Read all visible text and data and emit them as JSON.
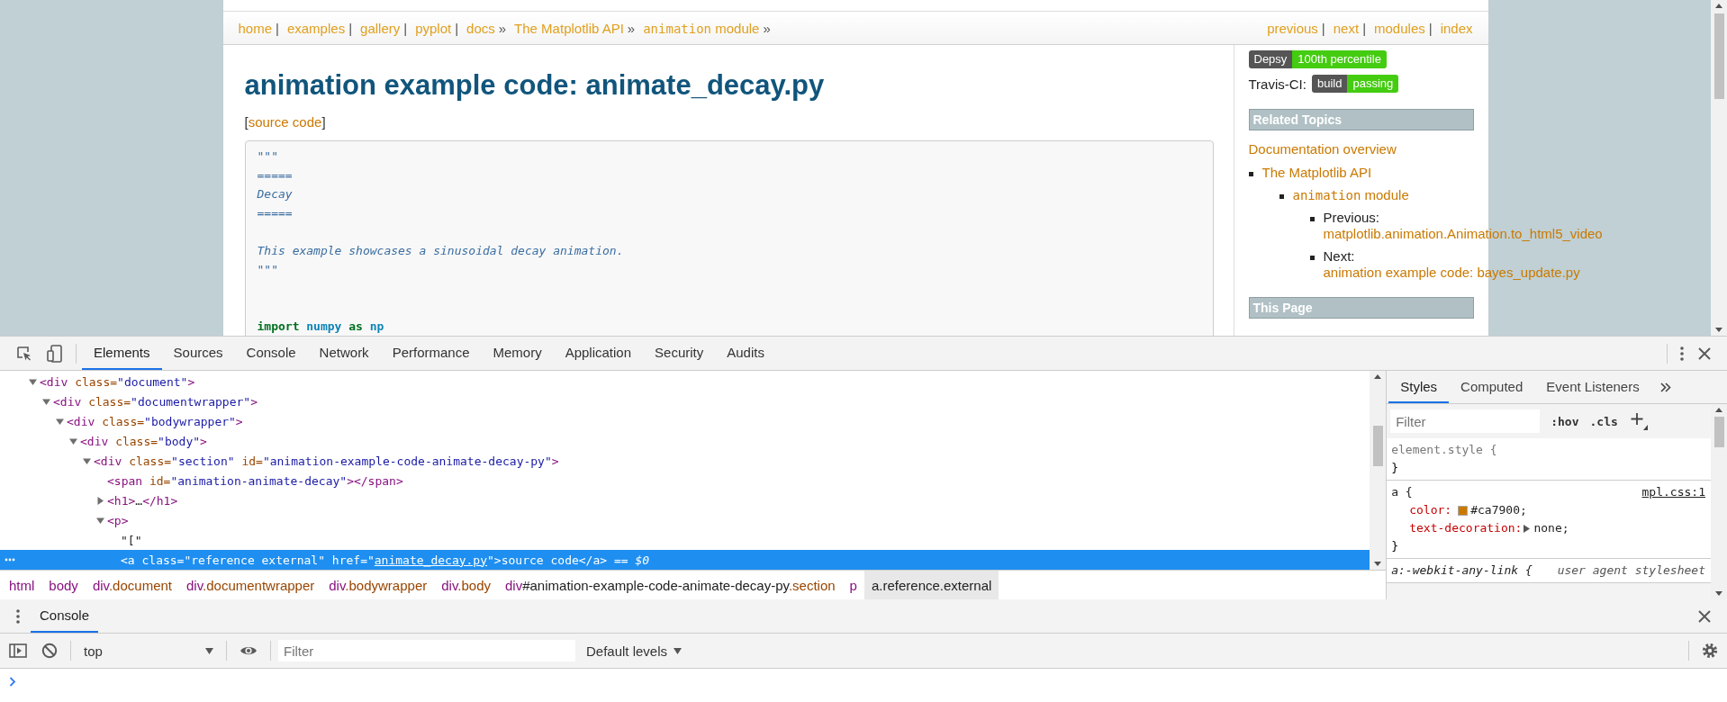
{
  "page": {
    "nav_left": [
      {
        "label": "home",
        "separator": "|"
      },
      {
        "label": "examples",
        "separator": "|"
      },
      {
        "label": "gallery",
        "separator": "|"
      },
      {
        "label": "pyplot",
        "separator": "|"
      },
      {
        "label": "docs",
        "separator": "»"
      },
      {
        "label": "The Matplotlib API",
        "separator": "»"
      },
      {
        "code": "animation",
        "label": "module",
        "separator": "»"
      }
    ],
    "nav_right": [
      {
        "label": "previous",
        "separator": "|"
      },
      {
        "label": "next",
        "separator": "|"
      },
      {
        "label": "modules",
        "separator": "|"
      },
      {
        "label": "index"
      }
    ],
    "title": "animation example code: animate_decay.py",
    "source_link": {
      "open": "[",
      "label": "source code",
      "close": "]"
    },
    "code_lines": [
      {
        "kind": "doc",
        "text": "\"\"\""
      },
      {
        "kind": "doc",
        "text": "====="
      },
      {
        "kind": "doc",
        "text": "Decay"
      },
      {
        "kind": "doc",
        "text": "====="
      },
      {
        "kind": "blank"
      },
      {
        "kind": "doc",
        "text": "This example showcases a sinusoidal decay animation."
      },
      {
        "kind": "doc",
        "text": "\"\"\""
      },
      {
        "kind": "blank"
      },
      {
        "kind": "blank"
      },
      {
        "kind": "code",
        "tokens": [
          {
            "kind": "kw",
            "text": "import"
          },
          {
            "kind": "name",
            "text": "numpy"
          },
          {
            "kind": "kw",
            "text": "as"
          },
          {
            "kind": "name",
            "text": "np"
          }
        ]
      }
    ],
    "sidebar": {
      "badges": [
        {
          "label": "Depsy",
          "value": "100th percentile"
        }
      ],
      "travis": {
        "label": "Travis-CI:",
        "badge": {
          "label": "build",
          "value": "passing"
        }
      },
      "related_title": "Related Topics",
      "overview": "Documentation overview",
      "topics": [
        {
          "label": "The Matplotlib API",
          "children": [
            {
              "code": "animation",
              "label": "module",
              "children": [
                {
                  "prefix": "Previous:",
                  "label": "matplotlib.animation.Animation.to_html5_video"
                },
                {
                  "prefix": "Next:",
                  "label": "animation example code: bayes_update.py"
                }
              ]
            }
          ]
        }
      ],
      "this_page_title": "This Page"
    }
  },
  "devtools": {
    "tabs": [
      {
        "label": "Elements",
        "selected": true
      },
      {
        "label": "Sources",
        "selected": false
      },
      {
        "label": "Console",
        "selected": false
      },
      {
        "label": "Network",
        "selected": false
      },
      {
        "label": "Performance",
        "selected": false
      },
      {
        "label": "Memory",
        "selected": false
      },
      {
        "label": "Application",
        "selected": false
      },
      {
        "label": "Security",
        "selected": false
      },
      {
        "label": "Audits",
        "selected": false
      }
    ],
    "tree": [
      {
        "expanded": true,
        "selected": false,
        "tokens": [
          {
            "kind": "tag",
            "text": "<div"
          },
          {
            "kind": "attr",
            "text": " class="
          },
          {
            "kind": "value",
            "text": "\"document\""
          },
          {
            "kind": "tag",
            "text": ">"
          }
        ],
        "children": [
          {
            "expanded": true,
            "selected": false,
            "tokens": [
              {
                "kind": "tag",
                "text": "<div"
              },
              {
                "kind": "attr",
                "text": " class="
              },
              {
                "kind": "value",
                "text": "\"documentwrapper\""
              },
              {
                "kind": "tag",
                "text": ">"
              }
            ],
            "children": [
              {
                "expanded": true,
                "selected": false,
                "tokens": [
                  {
                    "kind": "tag",
                    "text": "<div"
                  },
                  {
                    "kind": "attr",
                    "text": " class="
                  },
                  {
                    "kind": "value",
                    "text": "\"bodywrapper\""
                  },
                  {
                    "kind": "tag",
                    "text": ">"
                  }
                ],
                "children": [
                  {
                    "expanded": true,
                    "selected": false,
                    "tokens": [
                      {
                        "kind": "tag",
                        "text": "<div"
                      },
                      {
                        "kind": "attr",
                        "text": " class="
                      },
                      {
                        "kind": "value",
                        "text": "\"body\""
                      },
                      {
                        "kind": "tag",
                        "text": ">"
                      }
                    ],
                    "children": [
                      {
                        "expanded": true,
                        "selected": false,
                        "tokens": [
                          {
                            "kind": "tag",
                            "text": "<div"
                          },
                          {
                            "kind": "attr",
                            "text": " class="
                          },
                          {
                            "kind": "value",
                            "text": "\"section\""
                          },
                          {
                            "kind": "attr",
                            "text": " id="
                          },
                          {
                            "kind": "value",
                            "text": "\"animation-example-code-animate-decay-py\""
                          },
                          {
                            "kind": "tag",
                            "text": ">"
                          }
                        ],
                        "children": [
                          {
                            "selected": false,
                            "tokens": [
                              {
                                "kind": "tag",
                                "text": "<span"
                              },
                              {
                                "kind": "attr",
                                "text": " id="
                              },
                              {
                                "kind": "value",
                                "text": "\"animation-animate-decay\""
                              },
                              {
                                "kind": "tag",
                                "text": "></span>"
                              }
                            ]
                          },
                          {
                            "expanded": false,
                            "selected": false,
                            "tokens": [
                              {
                                "kind": "tag",
                                "text": "<h1>"
                              },
                              {
                                "kind": "text",
                                "text": "…"
                              },
                              {
                                "kind": "tag",
                                "text": "</h1>"
                              }
                            ]
                          },
                          {
                            "expanded": true,
                            "selected": false,
                            "tokens": [
                              {
                                "kind": "tag",
                                "text": "<p>"
                              }
                            ],
                            "children": [
                              {
                                "selected": false,
                                "tokens": [
                                  {
                                    "kind": "text",
                                    "text": "\"[\""
                                  }
                                ]
                              },
                              {
                                "selected": true,
                                "tokens": [
                                  {
                                    "kind": "tag",
                                    "text": "<a"
                                  },
                                  {
                                    "kind": "attr",
                                    "text": " class="
                                  },
                                  {
                                    "kind": "value",
                                    "text": "\"reference external\""
                                  },
                                  {
                                    "kind": "attr",
                                    "text": " href="
                                  },
                                  {
                                    "kind": "value",
                                    "text": "\""
                                  },
                                  {
                                    "kind": "link",
                                    "text": "animate_decay.py"
                                  },
                                  {
                                    "kind": "value",
                                    "text": "\""
                                  },
                                  {
                                    "kind": "tag",
                                    "text": ">"
                                  },
                                  {
                                    "kind": "text",
                                    "text": "source code"
                                  },
                                  {
                                    "kind": "tag",
                                    "text": "</a>"
                                  },
                                  {
                                    "kind": "hint",
                                    "text": " == $0"
                                  }
                                ]
                              }
                            ]
                          }
                        ]
                      }
                    ]
                  }
                ]
              }
            ]
          }
        ]
      }
    ],
    "breadcrumbs": [
      {
        "selected": false,
        "parts": [
          {
            "kind": "tag",
            "text": "html"
          }
        ]
      },
      {
        "selected": false,
        "parts": [
          {
            "kind": "tag",
            "text": "body"
          }
        ]
      },
      {
        "selected": false,
        "parts": [
          {
            "kind": "tag",
            "text": "div"
          },
          {
            "kind": "cls",
            "text": ".document"
          }
        ]
      },
      {
        "selected": false,
        "parts": [
          {
            "kind": "tag",
            "text": "div"
          },
          {
            "kind": "cls",
            "text": ".documentwrapper"
          }
        ]
      },
      {
        "selected": false,
        "parts": [
          {
            "kind": "tag",
            "text": "div"
          },
          {
            "kind": "cls",
            "text": ".bodywrapper"
          }
        ]
      },
      {
        "selected": false,
        "parts": [
          {
            "kind": "tag",
            "text": "div"
          },
          {
            "kind": "cls",
            "text": ".body"
          }
        ]
      },
      {
        "selected": false,
        "parts": [
          {
            "kind": "tag",
            "text": "div"
          },
          {
            "kind": "id",
            "text": "#animation-example-code-animate-decay-py"
          },
          {
            "kind": "cls",
            "text": ".section"
          }
        ]
      },
      {
        "selected": false,
        "parts": [
          {
            "kind": "tag",
            "text": "p"
          }
        ]
      },
      {
        "selected": true,
        "parts": [
          {
            "kind": "tag",
            "text": "a"
          },
          {
            "kind": "cls",
            "text": ".reference.external"
          }
        ]
      }
    ],
    "styles": {
      "tabs": [
        {
          "label": "Styles",
          "selected": true
        },
        {
          "label": "Computed",
          "selected": false
        },
        {
          "label": "Event Listeners",
          "selected": false
        }
      ],
      "filter_placeholder": "Filter",
      "hov": ":hov",
      "cls": ".cls",
      "rules": [
        {
          "kind": "inline",
          "selector": "element.style {",
          "close": "}"
        },
        {
          "kind": "author",
          "selector": "a {",
          "source": "mpl.css:1",
          "close": "}",
          "props": [
            {
              "name": "color:",
              "value": "#ca7900;",
              "color": "#ca7900"
            },
            {
              "name": "text-decoration:",
              "value": "none;",
              "expanded": false
            }
          ]
        },
        {
          "kind": "user-agent",
          "selector": "a:-webkit-any-link {",
          "source": "user agent stylesheet"
        }
      ]
    }
  },
  "console": {
    "tabs": [
      {
        "label": "Console",
        "selected": true
      }
    ],
    "context": "top",
    "filter_placeholder": "Filter",
    "levels": "Default levels"
  }
}
